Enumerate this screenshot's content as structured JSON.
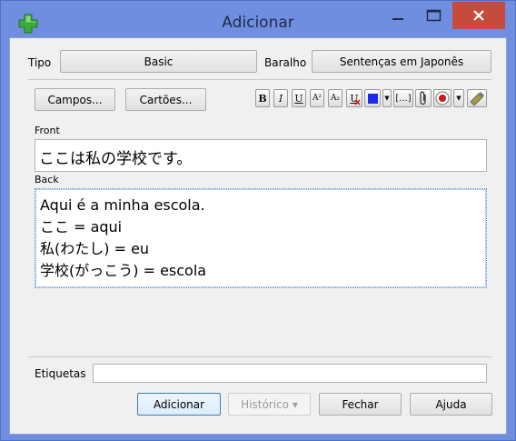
{
  "window": {
    "title": "Adicionar",
    "colors": {
      "frame": "#6f8ee0",
      "close": "#c74b3c",
      "client": "#f0f0f0"
    }
  },
  "top_row": {
    "tipo_label": "Tipo",
    "tipo_value": "Basic",
    "baralho_label": "Baralho",
    "baralho_value": "Sentenças em Japonês"
  },
  "buttons": {
    "campos": "Campos...",
    "cartoes": "Cartões..."
  },
  "toolbar": {
    "bold": "B",
    "italic": "I",
    "underline": "U",
    "superscript": "A²",
    "subscript": "A₂",
    "clear_format": "U",
    "text_color": "#1a2bf0",
    "cloze": "[...]"
  },
  "fields": {
    "front_label": "Front",
    "front_value": "ここは私の学校です。",
    "back_label": "Back",
    "back_lines": [
      "Aqui é a minha escola.",
      "ここ = aqui",
      "私(わたし) = eu",
      "学校(がっこう) = escola"
    ]
  },
  "tags": {
    "label": "Etiquetas",
    "value": ""
  },
  "footer": {
    "adicionar": "Adicionar",
    "historico": "Histórico ▾",
    "fechar": "Fechar",
    "ajuda": "Ajuda"
  }
}
